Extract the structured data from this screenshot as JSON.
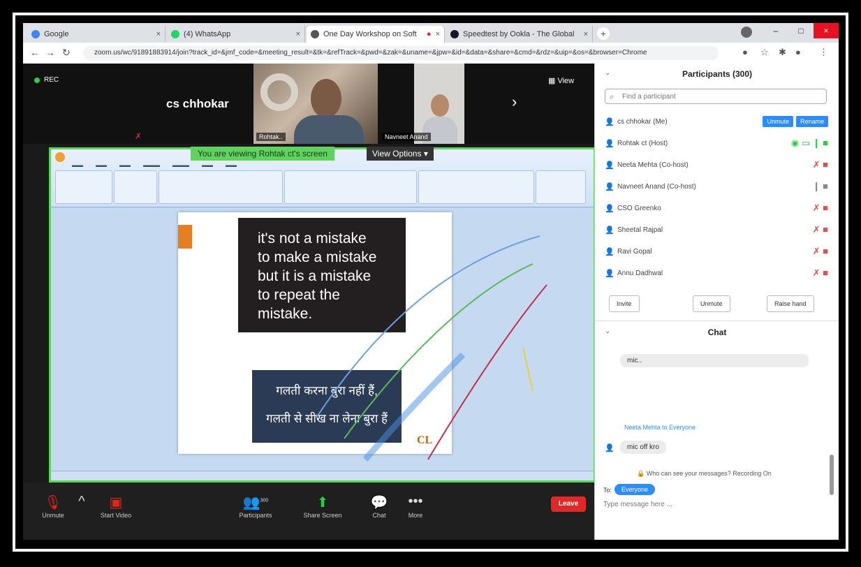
{
  "browser": {
    "tabs": [
      {
        "label": "Google",
        "color": "#4285f4"
      },
      {
        "label": "(4) WhatsApp",
        "color": "#25d366"
      },
      {
        "label": "One Day Workshop on Soft",
        "color": "#555555"
      },
      {
        "label": "Speedtest by Ookla - The Global",
        "color": "#141526"
      }
    ],
    "url": "zoom.us/wc/91891883914/join?track_id=&jmf_code=&meeting_result=&tk=&refTrack=&pwd=&zak=&uname=&jpw=&id=&data=&share=&cmd=&rdz=&uip=&os=&browser=Chrome"
  },
  "meeting": {
    "rec_label": "REC",
    "speaker_name": "cs chhokar",
    "tile_names": [
      "Rohtak..",
      "Navneet Anand"
    ],
    "view_label": "View",
    "viewing_banner": "You are viewing Rohtak ct's screen",
    "view_options": "View Options ▾"
  },
  "slide": {
    "quote_lines": [
      "it's not a mistake",
      "to make a mistake",
      "but it is a mistake",
      "to repeat the",
      "mistake."
    ],
    "hindi_lines": [
      "गलती करना बुरा नहीं हैं,",
      "गलती से सीख ना लेना बुरा हैं"
    ],
    "logo": "CL"
  },
  "toolbar": {
    "unmute": "Unmute",
    "start_video": "Start Video",
    "participants": "Participants",
    "participants_count": "300",
    "share_screen": "Share Screen",
    "chat": "Chat",
    "more": "More",
    "leave": "Leave"
  },
  "participants": {
    "title": "Participants (300)",
    "search_placeholder": "Find a participant",
    "list": [
      {
        "name": "cs chhokar (Me)",
        "icons": ""
      },
      {
        "name": "Rohtak ct (Host)",
        "icons": "◉ ▭ ❙ ■"
      },
      {
        "name": "Neeta Mehta (Co-host)",
        "icons": "✗ ■"
      },
      {
        "name": "Navneet Anand (Co-host)",
        "icons": "❙ ■"
      },
      {
        "name": "CSO Greenko",
        "icons": "✗ ■"
      },
      {
        "name": "Sheetal Rajpal",
        "icons": "✗ ■"
      },
      {
        "name": "Ravi Gopal",
        "icons": "✗ ■"
      },
      {
        "name": "Annu Dadhwal",
        "icons": "✗ ■"
      }
    ],
    "unmute_btn": "Unmute",
    "rename_btn": "Rename",
    "invite": "Invite",
    "unmute_me": "Unmute",
    "raise_hand": "Raise hand"
  },
  "chat": {
    "title": "Chat",
    "msg1": "mic..",
    "sender": "Neeta Mehta  to  Everyone",
    "msg2": "mic off kro",
    "note": "Who can see your messages? Recording On",
    "to_label": "To:",
    "to_value": "Everyone",
    "input_placeholder": "Type message here ..."
  }
}
